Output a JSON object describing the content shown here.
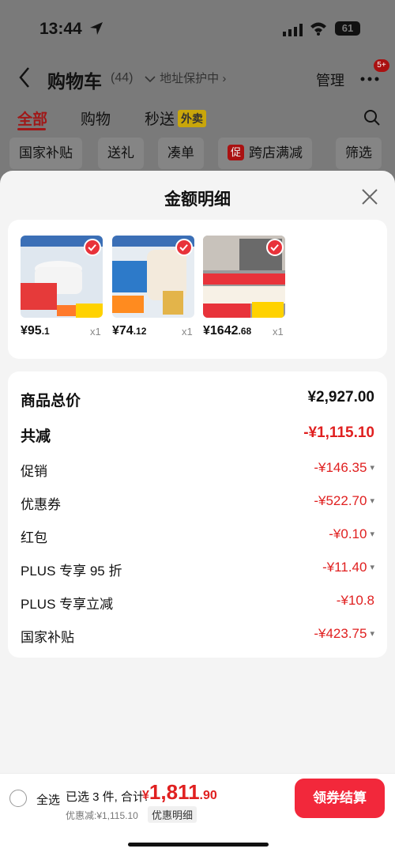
{
  "status_bar": {
    "time": "13:44",
    "battery": "61"
  },
  "nav": {
    "title": "购物车",
    "count": "(44)",
    "address": "地址保护中 ›",
    "manage": "管理",
    "badge": "5+"
  },
  "tabs": [
    {
      "label": "全部",
      "active": true
    },
    {
      "label": "购物",
      "active": false
    },
    {
      "label": "秒送",
      "active": false,
      "tag": "外卖"
    }
  ],
  "chips": [
    {
      "label": "国家补贴"
    },
    {
      "label": "送礼"
    },
    {
      "label": "凑单"
    },
    {
      "label": "跨店满减",
      "tag": "促"
    },
    {
      "label": "筛选"
    }
  ],
  "sheet": {
    "title": "金额明细",
    "products": [
      {
        "price_int": "¥95",
        "price_dec": ".1",
        "qty": "x1",
        "checked": true
      },
      {
        "price_int": "¥74",
        "price_dec": ".12",
        "qty": "x1",
        "checked": true
      },
      {
        "price_int": "¥1642",
        "price_dec": ".68",
        "qty": "x1",
        "checked": true
      }
    ],
    "summary": [
      {
        "label": "商品总价",
        "value": "¥2,927.00",
        "style": "total"
      },
      {
        "label": "共减",
        "value": "-¥1,115.10",
        "style": "bold"
      },
      {
        "label": "促销",
        "value": "-¥146.35",
        "expandable": true
      },
      {
        "label": "优惠券",
        "value": "-¥522.70",
        "expandable": true
      },
      {
        "label": "红包",
        "value": "-¥0.10",
        "expandable": true
      },
      {
        "label": "PLUS 专享 95 折",
        "value": "-¥11.40",
        "expandable": true
      },
      {
        "label": "PLUS 专享立减",
        "value": "-¥10.8",
        "expandable": false
      },
      {
        "label": "国家补贴",
        "value": "-¥423.75",
        "expandable": true
      }
    ]
  },
  "bottom": {
    "select_all": "全选",
    "selected_text": "已选 3 件, 合计:",
    "currency": "¥",
    "total_int": "1,811",
    "total_dec": ".90",
    "discount": "优惠减:¥1,115.10",
    "detail_link": "优惠明细",
    "checkout": "领券结算"
  },
  "colors": {
    "accent": "#e02020",
    "checkout": "#f2283b"
  }
}
